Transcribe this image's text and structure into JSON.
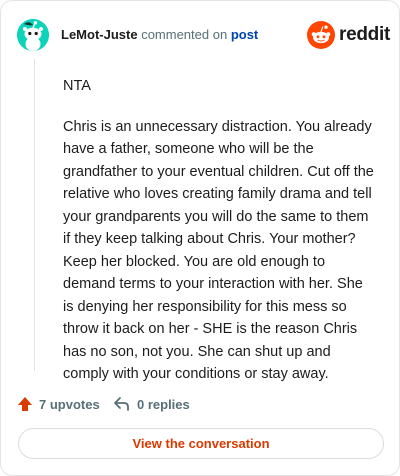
{
  "comment": {
    "username": "LeMot-Juste",
    "action": "commented on",
    "target": "post",
    "brand": "reddit",
    "paragraphs": [
      "NTA",
      "Chris is an unnecessary distraction. You already have a father, someone who will be the grandfather to your eventual children. Cut off the relative who loves creating family drama and tell your grandparents you will do the same to them if they keep talking about Chris. Your mother? Keep her blocked. You are old enough to demand terms to your interaction with her. She is denying her responsibility for this mess so throw it back on her - SHE is the reason Chris has no son, not you. She can shut up and comply with your conditions or stay away."
    ]
  },
  "footer": {
    "upvotes": "7 upvotes",
    "replies": "0 replies"
  },
  "cta": {
    "label": "View the conversation"
  },
  "colors": {
    "avatar_bg": "#0dd3bb",
    "brand_orange": "#ff4500",
    "upvote_orange": "#d93a00",
    "link_blue": "#0045ac"
  },
  "icons": [
    "snoo-avatar-icon",
    "reddit-logo-icon",
    "upvote-arrow-icon",
    "reply-arrow-icon"
  ]
}
